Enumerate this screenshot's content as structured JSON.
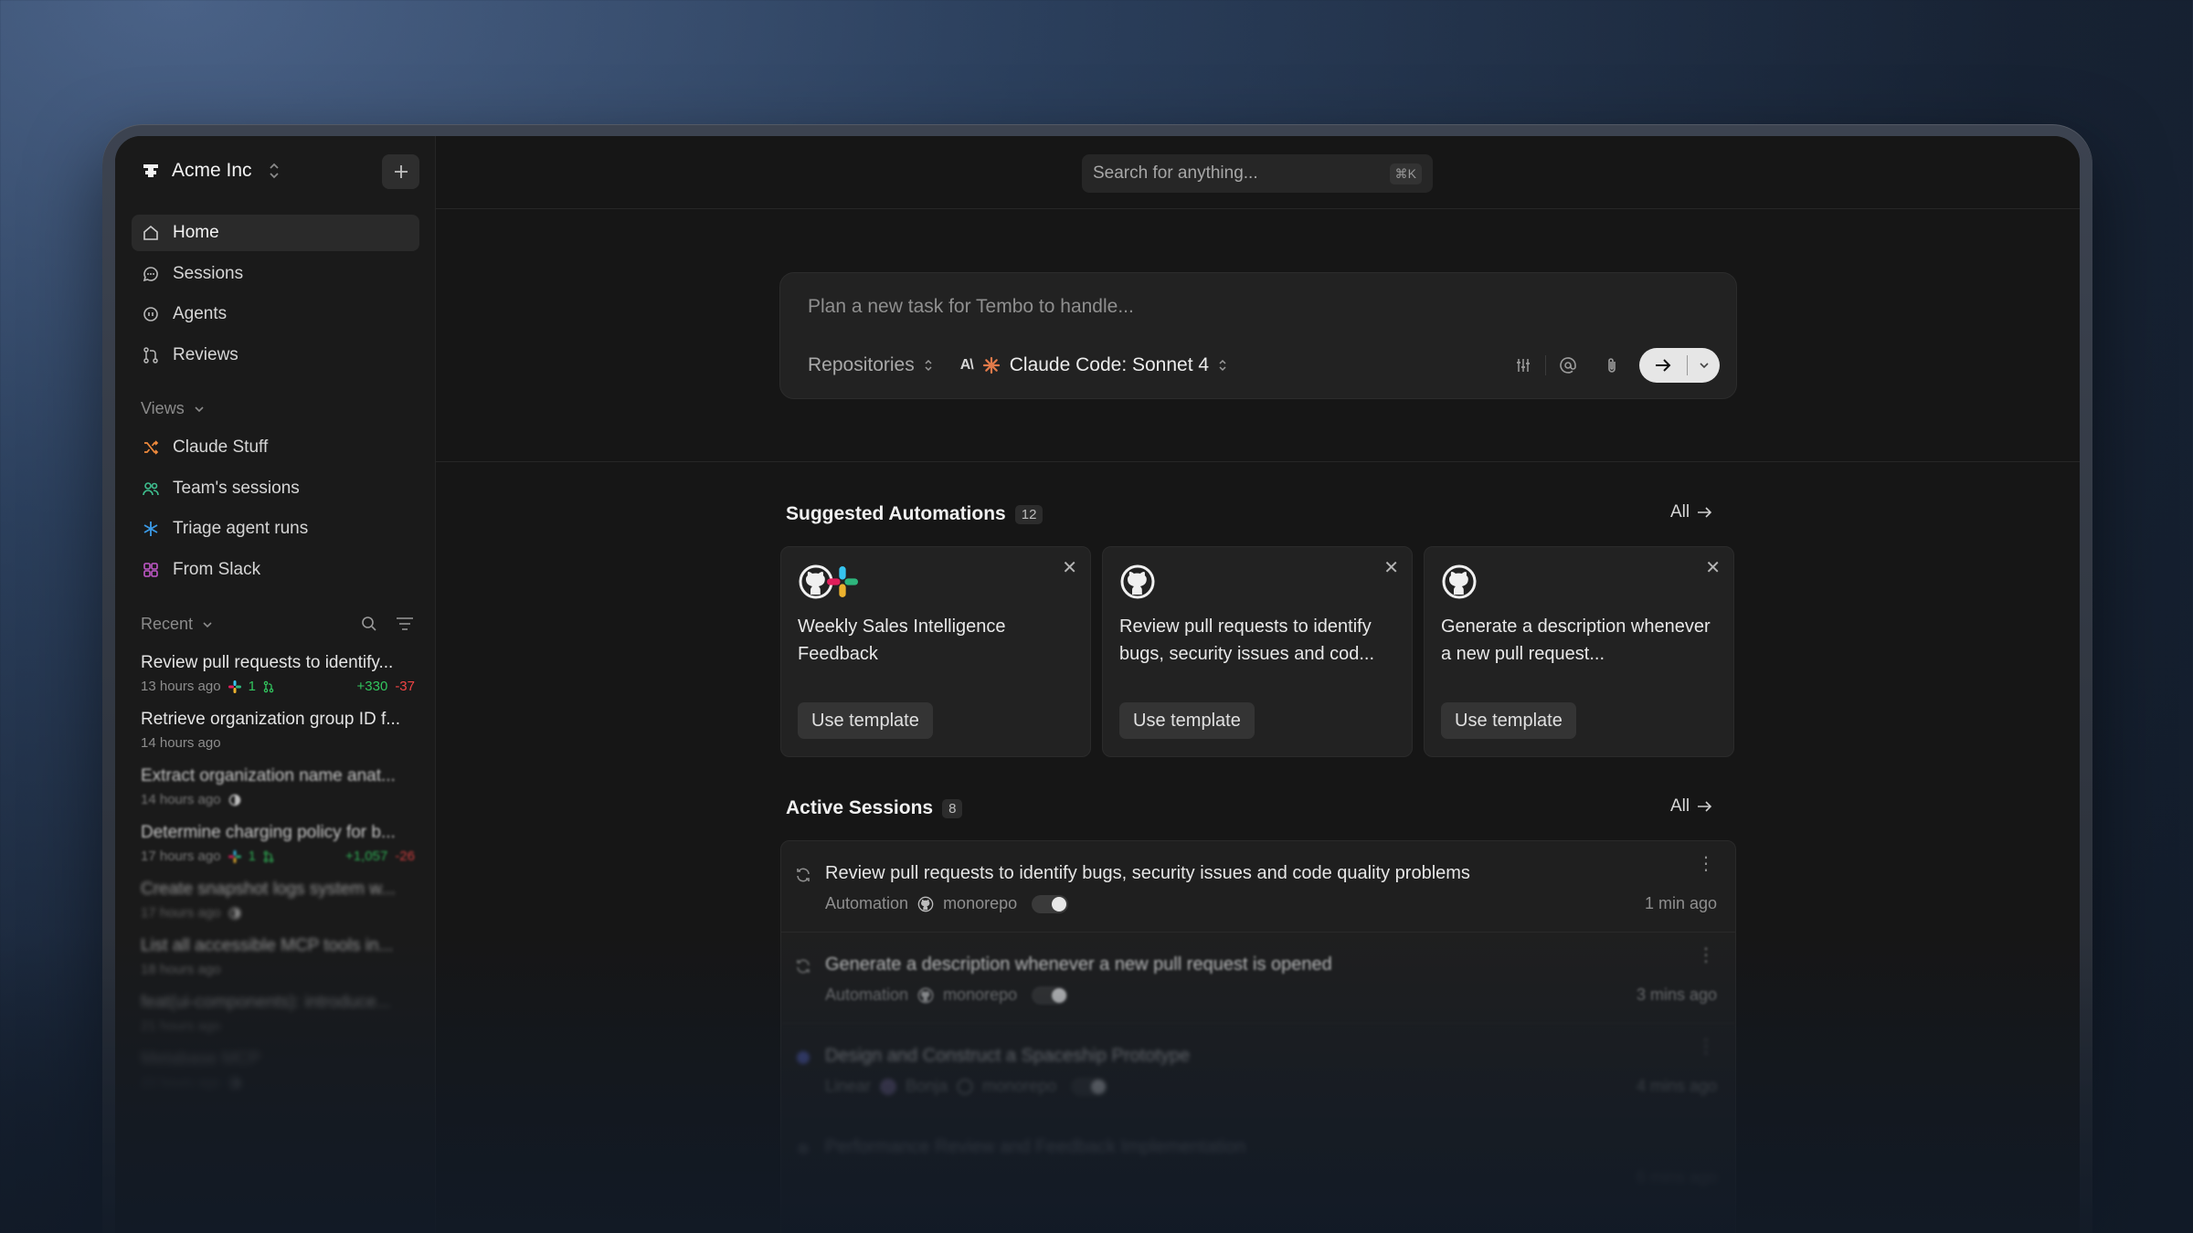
{
  "org": {
    "name": "Acme Inc"
  },
  "search": {
    "placeholder": "Search for anything...",
    "shortcut": "⌘K"
  },
  "nav": [
    {
      "label": "Home",
      "icon": "home-icon",
      "active": true
    },
    {
      "label": "Sessions",
      "icon": "chat-icon"
    },
    {
      "label": "Agents",
      "icon": "agent-icon"
    },
    {
      "label": "Reviews",
      "icon": "pull-request-icon"
    }
  ],
  "views": {
    "header": "Views",
    "items": [
      {
        "label": "Claude Stuff",
        "icon": "shuffle-icon",
        "color": "#f08a3c"
      },
      {
        "label": "Team's sessions",
        "icon": "users-icon",
        "color": "#3fbf8f"
      },
      {
        "label": "Triage agent runs",
        "icon": "asterisk-icon",
        "color": "#3b9be8"
      },
      {
        "label": "From Slack",
        "icon": "grid-icon",
        "color": "#c158c9"
      }
    ]
  },
  "recent": {
    "header": "Recent",
    "items": [
      {
        "title": "Review pull requests to identify...",
        "time": "13 hours ago",
        "prs": "1",
        "add": "+330",
        "del": "-37"
      },
      {
        "title": "Retrieve organization group ID f...",
        "time": "14 hours ago"
      },
      {
        "title": "Extract organization name anat...",
        "time": "14 hours ago"
      },
      {
        "title": "Determine charging policy for b...",
        "time": "17 hours ago",
        "prs": "1",
        "add": "+1,057",
        "del": "-26"
      },
      {
        "title": "Create snapshot logs system w...",
        "time": "17 hours ago"
      },
      {
        "title": "List all accessible MCP tools in...",
        "time": "18 hours ago"
      },
      {
        "title": "feat(ui-components): introduce...",
        "time": "21 hours ago"
      },
      {
        "title": "Metabase MCP",
        "time": "23 hours ago"
      }
    ]
  },
  "composer": {
    "placeholder": "Plan a new task for Tembo to handle...",
    "repositories": "Repositories",
    "model_prefix": "A\\",
    "model": "Claude Code: Sonnet 4"
  },
  "automations": {
    "title": "Suggested Automations",
    "count": "12",
    "all": "All",
    "cards": [
      {
        "text": "Weekly Sales Intelligence Feedback",
        "button": "Use template"
      },
      {
        "text": "Review pull requests to identify bugs, security issues and cod...",
        "button": "Use template"
      },
      {
        "text": "Generate a description whenever a new pull request...",
        "button": "Use template"
      }
    ]
  },
  "sessions": {
    "title": "Active Sessions",
    "count": "8",
    "all": "All",
    "rows": [
      {
        "title": "Review pull requests to identify bugs, security issues and code quality problems",
        "source": "Automation",
        "repo": "monorepo",
        "time": "1 min ago"
      },
      {
        "title": "Generate a description whenever a new pull request is opened",
        "source": "Automation",
        "repo": "monorepo",
        "time": "3 mins ago"
      },
      {
        "title": "Design and Construct a Spaceship Prototype",
        "source": "Linear",
        "user": "Bonja",
        "repo": "monorepo",
        "time": "4 mins ago"
      },
      {
        "title": "Performance Review and Feedback Implementation",
        "source": "",
        "repo": "",
        "time": "6 mins ago"
      }
    ]
  }
}
